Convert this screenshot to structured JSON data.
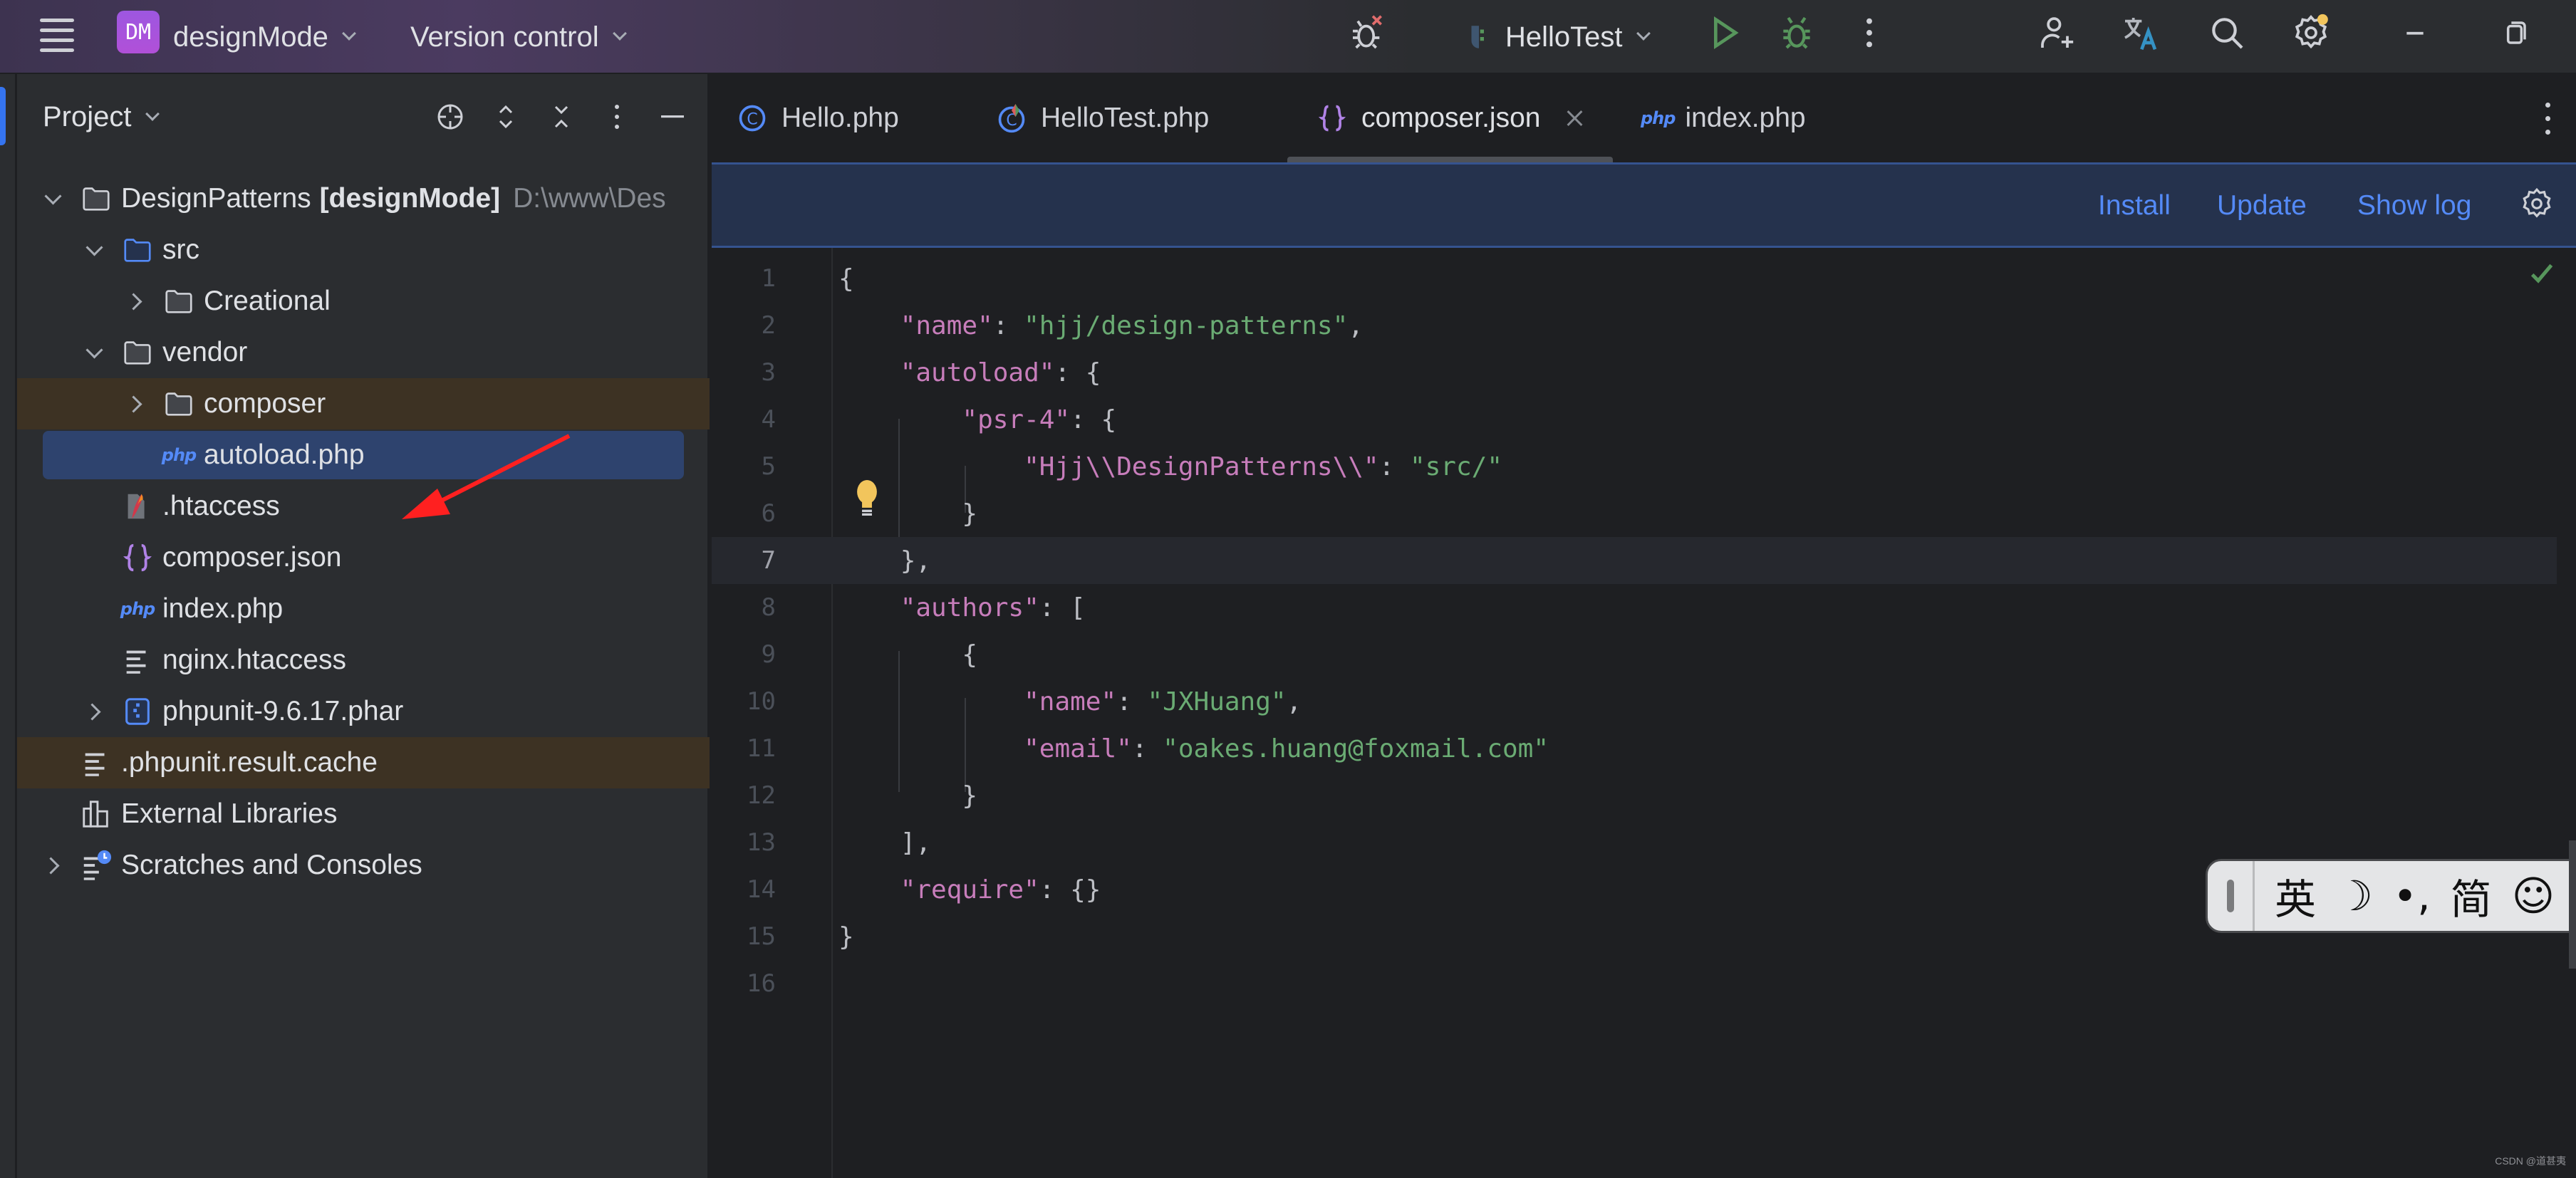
{
  "titlebar": {
    "project_badge": "DM",
    "project_name": "designMode",
    "vcs_label": "Version control",
    "run_config": "HelloTest",
    "colors": {
      "badge": "#a855e3",
      "run": "#57965c",
      "notification_dot": "#f2c55c"
    }
  },
  "project_panel": {
    "title": "Project",
    "tree": [
      {
        "label": "DesignPatterns",
        "module": "[designMode]",
        "path": "D:\\www\\Des",
        "level": 0,
        "expander": "down",
        "icon": "folder-icon"
      },
      {
        "label": "src",
        "level": 1,
        "expander": "down",
        "icon": "source-folder-icon"
      },
      {
        "label": "Creational",
        "level": 2,
        "expander": "right",
        "icon": "folder-icon"
      },
      {
        "label": "vendor",
        "level": 1,
        "expander": "down",
        "icon": "folder-icon"
      },
      {
        "label": "composer",
        "level": 2,
        "expander": "right",
        "icon": "folder-icon",
        "state": "modified"
      },
      {
        "label": "autoload.php",
        "level": 2,
        "expander": "none",
        "icon": "php-file-icon",
        "state": "selected"
      },
      {
        "label": ".htaccess",
        "level": 1,
        "expander": "none",
        "icon": "apache-file-icon"
      },
      {
        "label": "composer.json",
        "level": 1,
        "expander": "none",
        "icon": "json-file-icon"
      },
      {
        "label": "index.php",
        "level": 1,
        "expander": "none",
        "icon": "php-file-icon"
      },
      {
        "label": "nginx.htaccess",
        "level": 1,
        "expander": "none",
        "icon": "text-file-icon"
      },
      {
        "label": "phpunit-9.6.17.phar",
        "level": 1,
        "expander": "right",
        "icon": "archive-file-icon"
      },
      {
        "label": ".phpunit.result.cache",
        "level": 0,
        "expander": "none",
        "icon": "text-file-icon",
        "state": "modified"
      },
      {
        "label": "External Libraries",
        "level": 0,
        "expander": "none",
        "icon": "library-icon"
      },
      {
        "label": "Scratches and Consoles",
        "level": 0,
        "expander": "right",
        "icon": "scratches-icon"
      }
    ]
  },
  "tabs": [
    {
      "label": "Hello.php",
      "icon": "php-class-icon"
    },
    {
      "label": "HelloTest.php",
      "icon": "php-test-class-icon"
    },
    {
      "label": "composer.json",
      "icon": "json-file-icon",
      "active": true
    },
    {
      "label": "index.php",
      "icon": "php-file-icon"
    }
  ],
  "composer_banner": {
    "install": "Install",
    "update": "Update",
    "show_log": "Show log"
  },
  "editor": {
    "current_line": 7,
    "lines": [
      {
        "n": "1",
        "tokens": [
          [
            "p",
            "{"
          ]
        ]
      },
      {
        "n": "2",
        "tokens": [
          [
            "p",
            "    "
          ],
          [
            "k",
            "\"name\""
          ],
          [
            "p",
            ": "
          ],
          [
            "s",
            "\"hjj/design-patterns\""
          ],
          [
            "p",
            ","
          ]
        ]
      },
      {
        "n": "3",
        "tokens": [
          [
            "p",
            "    "
          ],
          [
            "k",
            "\"autoload\""
          ],
          [
            "p",
            ": {"
          ]
        ]
      },
      {
        "n": "4",
        "tokens": [
          [
            "p",
            "        "
          ],
          [
            "k",
            "\"psr-4\""
          ],
          [
            "p",
            ": {"
          ]
        ]
      },
      {
        "n": "5",
        "tokens": [
          [
            "p",
            "            "
          ],
          [
            "k",
            "\"Hjj\\\\DesignPatterns\\\\\""
          ],
          [
            "p",
            ": "
          ],
          [
            "s",
            "\"src/\""
          ]
        ]
      },
      {
        "n": "6",
        "tokens": [
          [
            "p",
            "        }"
          ]
        ]
      },
      {
        "n": "7",
        "tokens": [
          [
            "p",
            "    },"
          ]
        ]
      },
      {
        "n": "8",
        "tokens": [
          [
            "p",
            "    "
          ],
          [
            "k",
            "\"authors\""
          ],
          [
            "p",
            ": ["
          ]
        ]
      },
      {
        "n": "9",
        "tokens": [
          [
            "p",
            "        {"
          ]
        ]
      },
      {
        "n": "10",
        "tokens": [
          [
            "p",
            "            "
          ],
          [
            "k",
            "\"name\""
          ],
          [
            "p",
            ": "
          ],
          [
            "s",
            "\"JXHuang\""
          ],
          [
            "p",
            ","
          ]
        ]
      },
      {
        "n": "11",
        "tokens": [
          [
            "p",
            "            "
          ],
          [
            "k",
            "\"email\""
          ],
          [
            "p",
            ": "
          ],
          [
            "s",
            "\"oakes.huang@foxmail.com\""
          ]
        ]
      },
      {
        "n": "12",
        "tokens": [
          [
            "p",
            "        }"
          ]
        ]
      },
      {
        "n": "13",
        "tokens": [
          [
            "p",
            "    ],"
          ]
        ]
      },
      {
        "n": "14",
        "tokens": [
          [
            "p",
            "    "
          ],
          [
            "k",
            "\"require\""
          ],
          [
            "p",
            ": {}"
          ]
        ]
      },
      {
        "n": "15",
        "tokens": [
          [
            "p",
            "}"
          ]
        ]
      },
      {
        "n": "16",
        "tokens": []
      }
    ]
  },
  "ime_toolbar": {
    "items": [
      "英",
      "☽",
      "•,",
      "简",
      "☺"
    ]
  },
  "watermark": "CSDN @道甚夷"
}
